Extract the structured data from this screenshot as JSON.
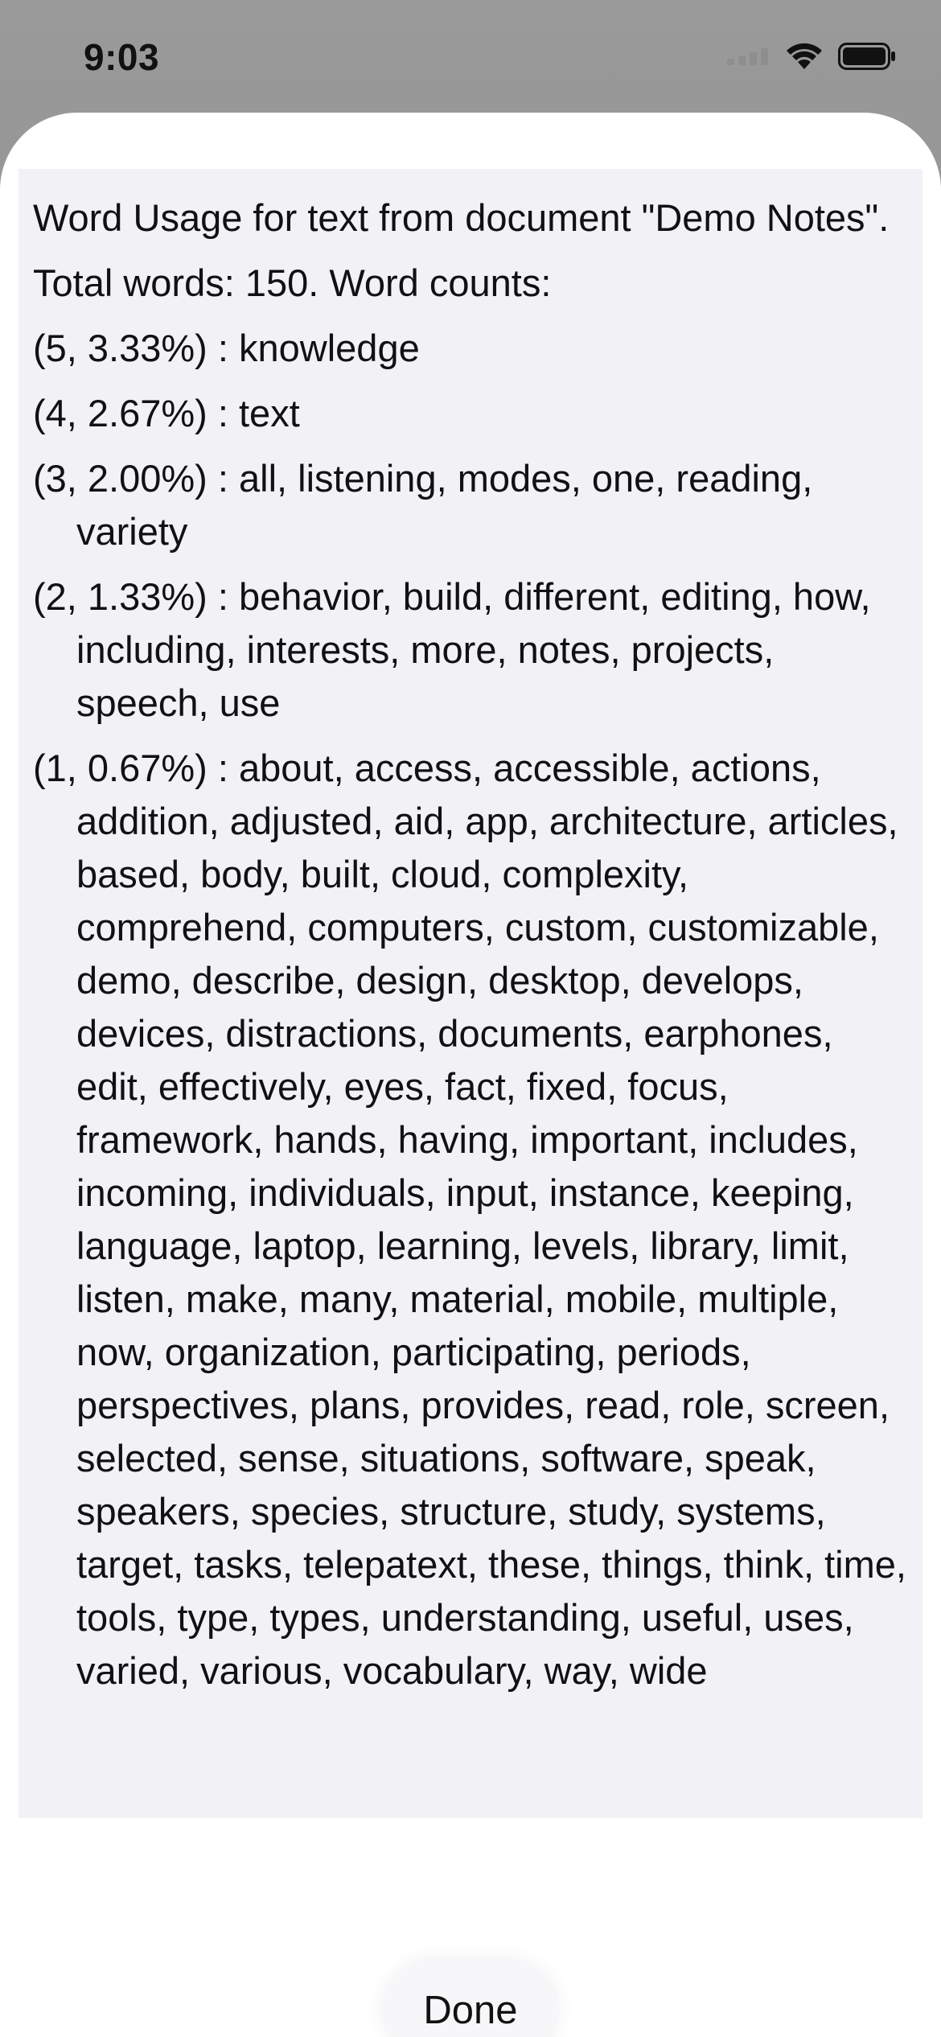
{
  "status_bar": {
    "time": "9:03",
    "icons": [
      "cellular-signal-icon",
      "wifi-icon",
      "battery-icon"
    ]
  },
  "report": {
    "title": "Word Usage for text from document \"Demo Notes\".",
    "total": "Total words: 150. Word counts:",
    "groups": [
      {
        "label": "(5, 3.33%)  :  knowledge"
      },
      {
        "label": "(4, 2.67%)  :  text"
      },
      {
        "label": "(3, 2.00%)  :  all, listening, modes, one, reading, variety"
      },
      {
        "label": "(2, 1.33%)  :  behavior, build, different, editing, how, including, interests, more, notes, projects, speech, use"
      },
      {
        "label": "(1, 0.67%)  :  about, access, accessible, actions, addition, adjusted, aid, app, architecture, articles, based, body, built, cloud, complexity, comprehend, computers, custom, customizable, demo, describe, design, desktop, develops, devices, distractions, documents, earphones, edit, effectively, eyes, fact, fixed, focus, framework, hands, having, important, includes, incoming, individuals, input, instance, keeping, language, laptop, learning, levels, library, limit, listen, make, many, material, mobile, multiple, now, organization, participating, periods, perspectives, plans, provides, read, role, screen, selected, sense, situations, software, speak, speakers, species, structure, study, systems, target, tasks, telepatext, these, things, think, time, tools, type, types, understanding, useful, uses, varied, various, vocabulary, way, wide"
      }
    ]
  },
  "actions": {
    "done_label": "Done"
  }
}
